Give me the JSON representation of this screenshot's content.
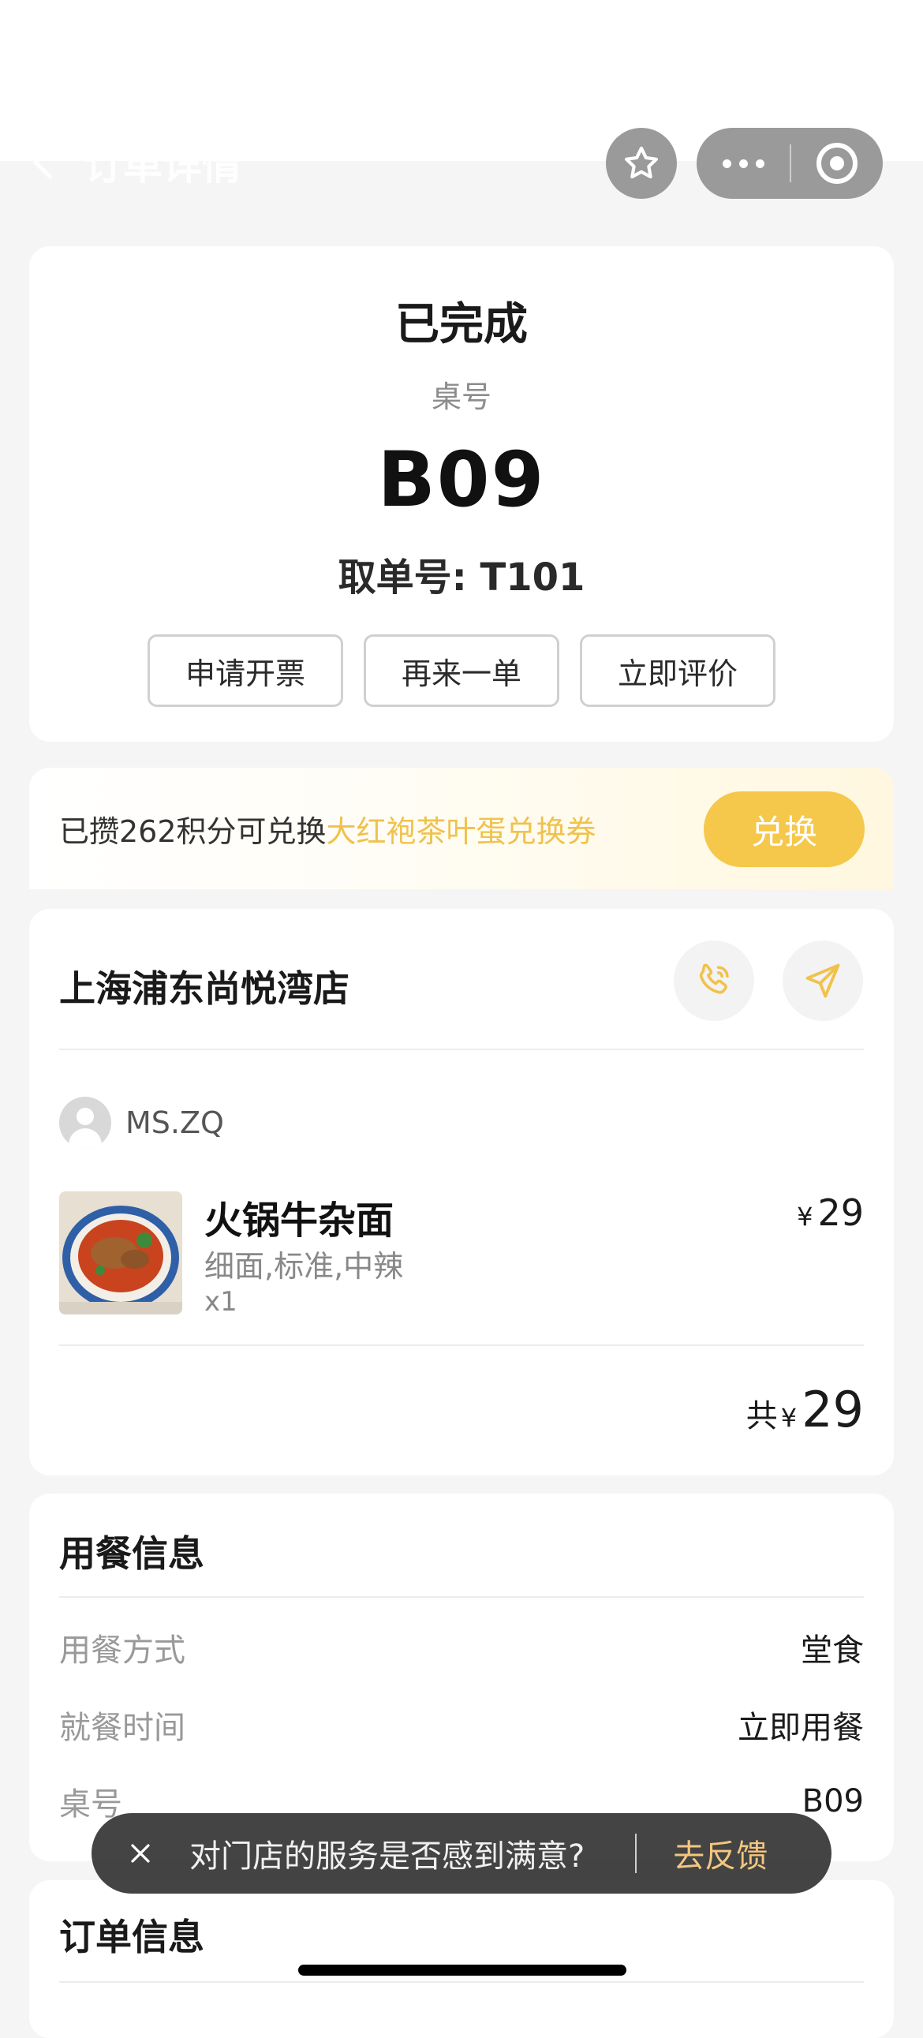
{
  "nav": {
    "title": "订单详情"
  },
  "order_status": {
    "status": "已完成",
    "table_label": "桌号",
    "table_number": "B09",
    "pickup_label": "取单号: T101",
    "actions": [
      "申请开票",
      "再来一单",
      "立即评价"
    ]
  },
  "points_banner": {
    "text": "已攒262积分可兑换",
    "highlight": "大红袍茶叶蛋兑换券",
    "button": "兑换"
  },
  "store": {
    "name": "上海浦东尚悦湾店",
    "user_name": "MS.ZQ",
    "item": {
      "name": "火锅牛杂面",
      "options": "细面,标准,中辣",
      "quantity": "x1",
      "currency": "¥",
      "price": "29"
    },
    "total_label": "共",
    "total_currency": "¥",
    "total_amount": "29"
  },
  "dining_info": {
    "title": "用餐信息",
    "rows": [
      {
        "label": "用餐方式",
        "value": "堂食"
      },
      {
        "label": "就餐时间",
        "value": "立即用餐"
      },
      {
        "label": "桌号",
        "value": "B09"
      }
    ]
  },
  "order_info": {
    "title": "订单信息"
  },
  "feedback_toast": {
    "message": "对门店的服务是否感到满意?",
    "action": "去反馈"
  },
  "colors": {
    "accent": "#f5c84c",
    "highlight_text": "#f0c24d",
    "toast_action": "#f3c77f"
  }
}
